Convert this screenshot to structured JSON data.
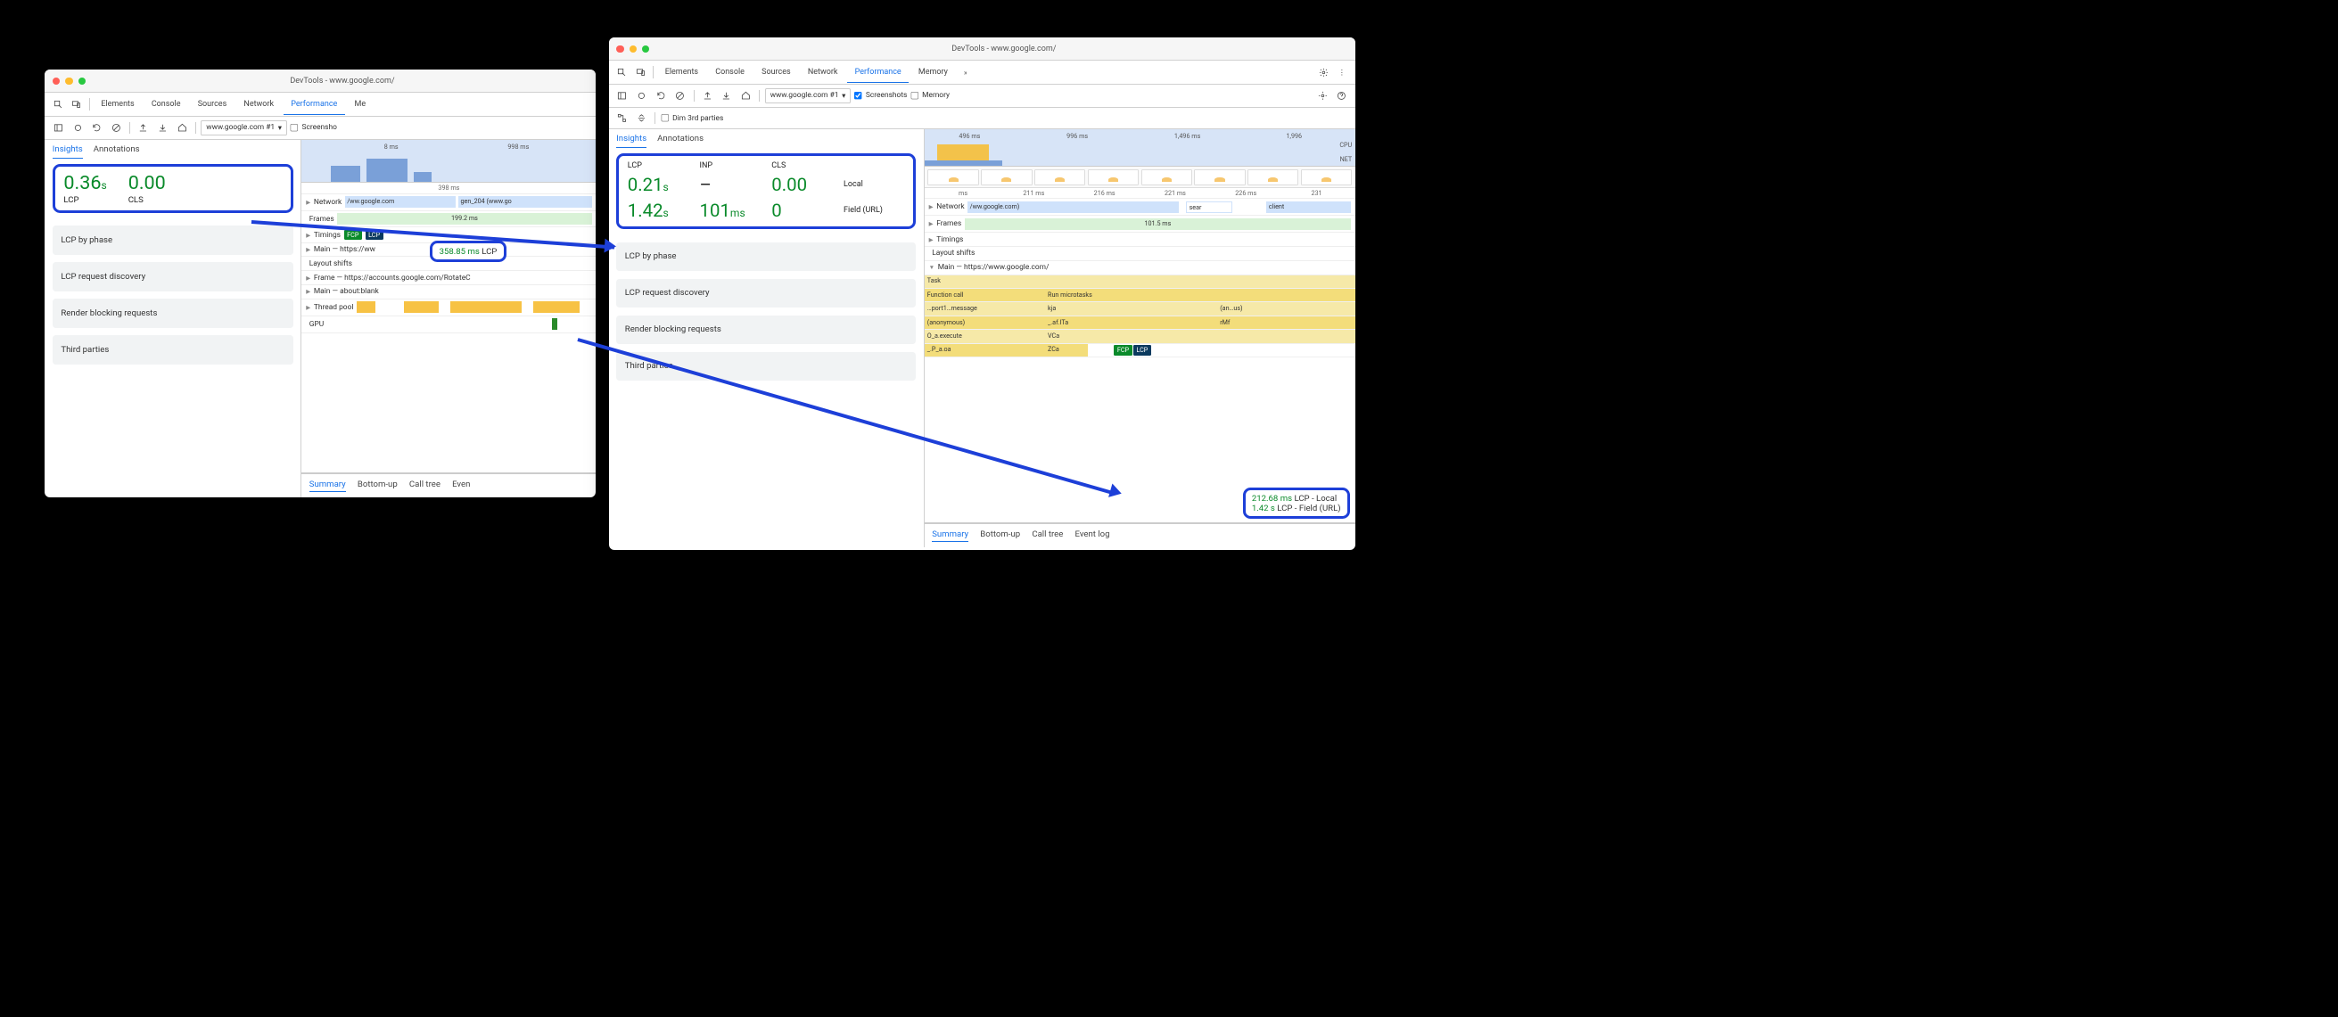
{
  "left": {
    "title": "DevTools - www.google.com/",
    "tabs": [
      "Elements",
      "Console",
      "Sources",
      "Network",
      "Performance",
      "Me"
    ],
    "active_tab": "Performance",
    "recording_selector": "www.google.com #1",
    "screenshots_label": "Screensho",
    "insights_tab": "Insights",
    "annotations_tab": "Annotations",
    "metrics": {
      "lcp_val": "0.36",
      "lcp_unit": "s",
      "lcp_label": "LCP",
      "cls_val": "0.00",
      "cls_label": "CLS"
    },
    "insight_items": [
      "LCP by phase",
      "LCP request discovery",
      "Render blocking requests",
      "Third parties"
    ],
    "overview_ticks": [
      "8 ms",
      "998 ms"
    ],
    "tracks": {
      "network": "Network",
      "network_items": [
        "/ww.google.com",
        "gen_204 (www.go"
      ],
      "frames": "Frames",
      "frames_time": "199.2 ms",
      "timings": "Timings",
      "main": "Main — https://ww",
      "layout_shifts": "Layout shifts",
      "frame2": "Frame — https://accounts.google.com/RotateC",
      "main2": "Main — about:blank",
      "thread_pool": "Thread pool",
      "gpu": "GPU"
    },
    "callout": {
      "time": "358.85 ms",
      "label": "LCP"
    },
    "summary_tabs": [
      "Summary",
      "Bottom-up",
      "Call tree",
      "Even"
    ]
  },
  "right": {
    "title": "DevTools - www.google.com/",
    "tabs": [
      "Elements",
      "Console",
      "Sources",
      "Network",
      "Performance",
      "Memory"
    ],
    "active_tab": "Performance",
    "recording_selector": "www.google.com #1",
    "screenshots_label": "Screenshots",
    "memory_label": "Memory",
    "dim_label": "Dim 3rd parties",
    "insights_tab": "Insights",
    "annotations_tab": "Annotations",
    "metrics_headers": [
      "LCP",
      "INP",
      "CLS"
    ],
    "metrics_local": {
      "lcp": "0.21",
      "lcp_unit": "s",
      "inp": "–",
      "cls": "0.00",
      "side": "Local"
    },
    "metrics_field": {
      "lcp": "1.42",
      "lcp_unit": "s",
      "inp": "101",
      "inp_unit": "ms",
      "cls": "0",
      "side": "Field (URL)"
    },
    "insight_items": [
      "LCP by phase",
      "LCP request discovery",
      "Render blocking requests",
      "Third parties"
    ],
    "overview_ticks": [
      "496 ms",
      "996 ms",
      "1,496 ms",
      "1,996"
    ],
    "cpu_label": "CPU",
    "net_label": "NET",
    "ruler": [
      "ms",
      "211 ms",
      "216 ms",
      "221 ms",
      "226 ms",
      "231"
    ],
    "tracks": {
      "network": "Network",
      "network_items": [
        "/ww.google.com)",
        "sear",
        "client"
      ],
      "frames": "Frames",
      "frames_time": "101.5 ms",
      "timings": "Timings",
      "layout_shifts": "Layout shifts",
      "main": "Main — https://www.google.com/"
    },
    "flame_rows": [
      [
        "Task",
        "",
        "",
        ""
      ],
      [
        "Function call",
        "Run microtasks",
        "",
        ""
      ],
      [
        "…port1…message",
        "kja",
        "",
        "(an…us)"
      ],
      [
        "(anonymous)",
        "_.af.ITa",
        "",
        "rMf"
      ],
      [
        "O_a.execute",
        "VCa",
        "",
        ""
      ],
      [
        "_.P_a.oa",
        "ZCa",
        "",
        ""
      ],
      [
        "",
        "FCP",
        "LCP",
        ""
      ]
    ],
    "callout": {
      "line1_time": "212.68 ms",
      "line1_label": "LCP - Local",
      "line2_time": "1.42 s",
      "line2_label": "LCP - Field (URL)"
    },
    "summary_tabs": [
      "Summary",
      "Bottom-up",
      "Call tree",
      "Event log"
    ]
  }
}
